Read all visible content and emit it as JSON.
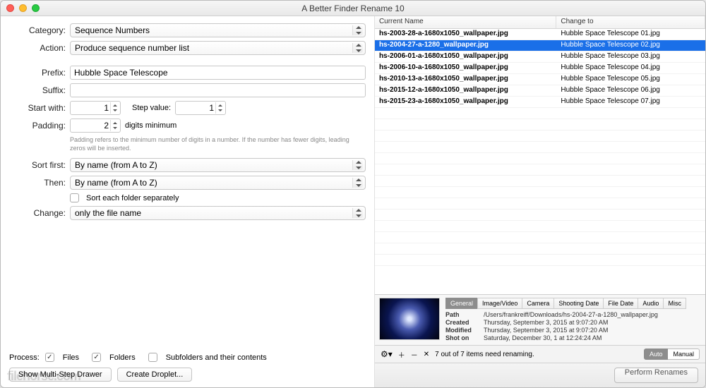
{
  "window": {
    "title": "A Better Finder Rename 10"
  },
  "labels": {
    "category": "Category:",
    "action": "Action:",
    "prefix": "Prefix:",
    "suffix": "Suffix:",
    "startwith": "Start with:",
    "stepvalue": "Step value:",
    "padding": "Padding:",
    "digitsmin": "digits minimum",
    "sortfirst": "Sort first:",
    "then": "Then:",
    "sorteach": "Sort each folder separately",
    "change": "Change:",
    "process": "Process:",
    "files": "Files",
    "folders": "Folders",
    "subfolders": "Subfolders and their contents",
    "showdrawer": "Show Multi-Step Drawer",
    "createdroplet": "Create Droplet...",
    "perform": "Perform Renames",
    "auto": "Auto",
    "manual": "Manual"
  },
  "values": {
    "category": "Sequence Numbers",
    "action": "Produce sequence number list",
    "prefix": "Hubble Space Telescope ",
    "suffix": "",
    "startwith": "1",
    "stepvalue": "1",
    "padding": "2",
    "sortfirst": "By name (from A to Z)",
    "then": "By name (from A to Z)",
    "change": "only the file name"
  },
  "hint": "Padding refers to the minimum number of digits in a number. If the number has fewer digits, leading zeros will be inserted.",
  "columns": {
    "current": "Current Name",
    "changeto": "Change to"
  },
  "rows": [
    {
      "current": "hs-2003-28-a-1680x1050_wallpaper.jpg",
      "to": "Hubble Space Telescope 01.jpg"
    },
    {
      "current": "hs-2004-27-a-1280_wallpaper.jpg",
      "to": "Hubble Space Telescope 02.jpg",
      "selected": true
    },
    {
      "current": "hs-2006-01-a-1680x1050_wallpaper.jpg",
      "to": "Hubble Space Telescope 03.jpg"
    },
    {
      "current": "hs-2006-10-a-1680x1050_wallpaper.jpg",
      "to": "Hubble Space Telescope 04.jpg"
    },
    {
      "current": "hs-2010-13-a-1680x1050_wallpaper.jpg",
      "to": "Hubble Space Telescope 05.jpg"
    },
    {
      "current": "hs-2015-12-a-1680x1050_wallpaper.jpg",
      "to": "Hubble Space Telescope 06.jpg"
    },
    {
      "current": "hs-2015-23-a-1680x1050_wallpaper.jpg",
      "to": "Hubble Space Telescope 07.jpg"
    }
  ],
  "detailTabs": [
    "General",
    "Image/Video",
    "Camera",
    "Shooting Date",
    "File Date",
    "Audio",
    "Misc"
  ],
  "meta": {
    "path_l": "Path",
    "path_v": "/Users/frankreiff/Downloads/hs-2004-27-a-1280_wallpaper.jpg",
    "created_l": "Created",
    "created_v": "Thursday, September 3, 2015 at 9:07:20 AM",
    "modified_l": "Modified",
    "modified_v": "Thursday, September 3, 2015 at 9:07:20 AM",
    "shoton_l": "Shot on",
    "shoton_v": "Saturday, December 30, 1 at 12:24:24 AM"
  },
  "status": "7 out of 7 items need renaming.",
  "watermark": "filehorse.com"
}
